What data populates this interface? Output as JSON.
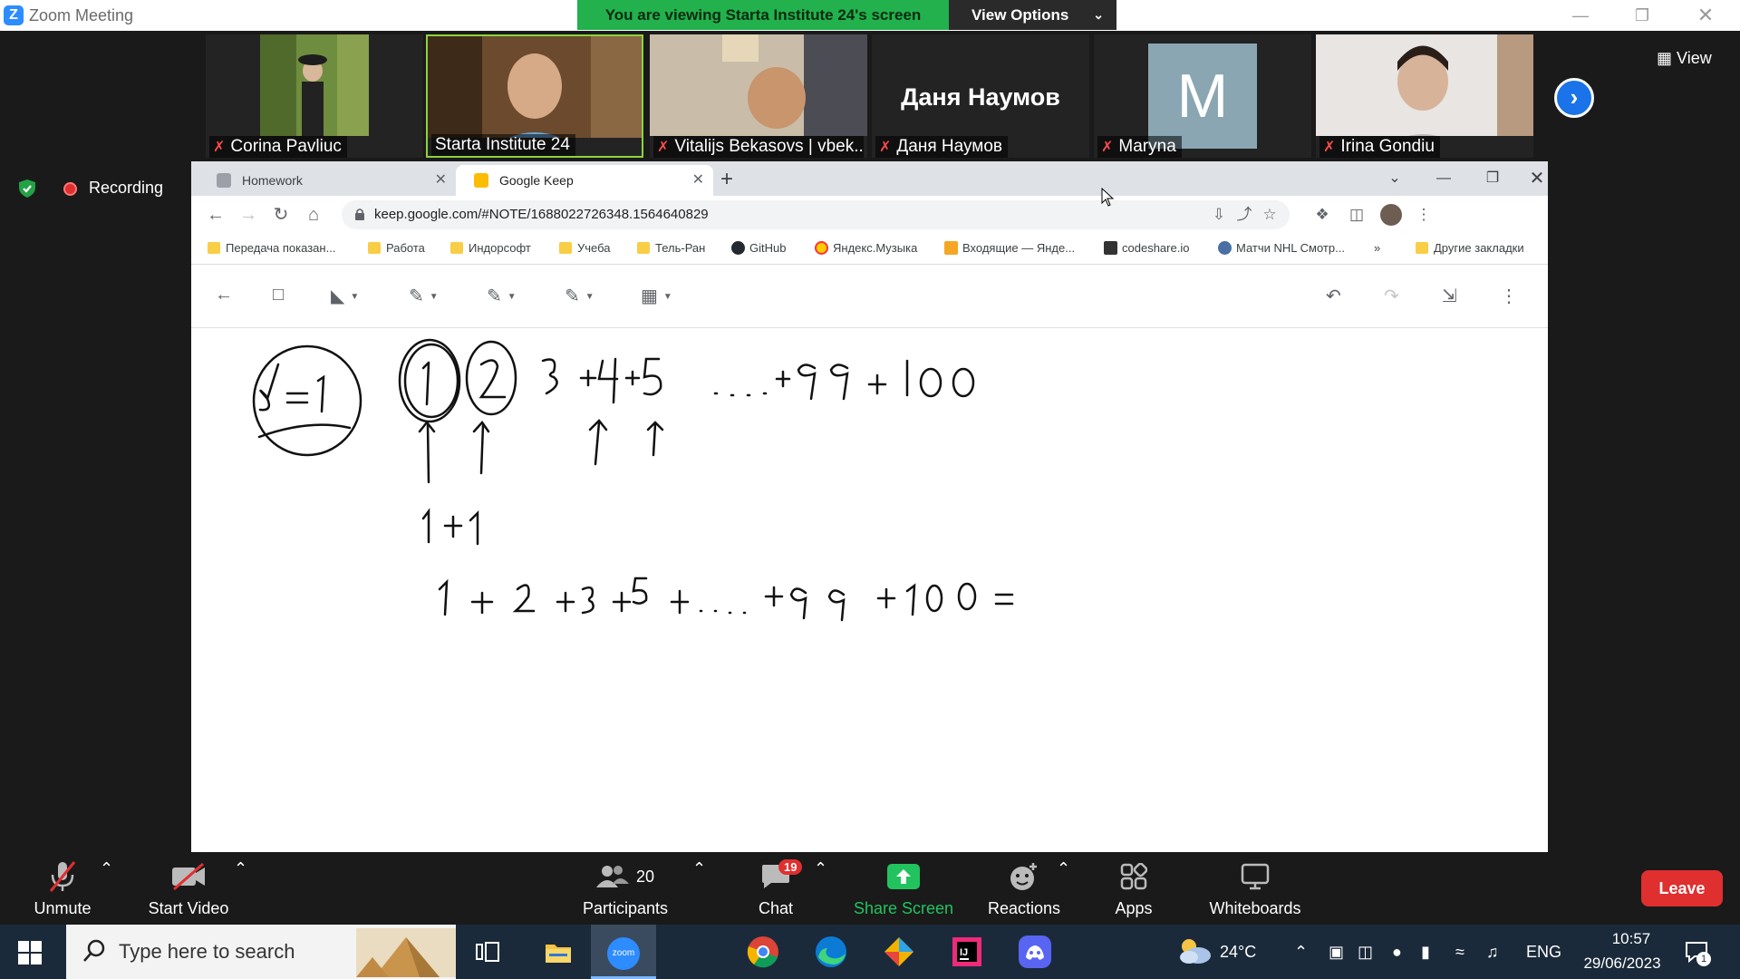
{
  "zoom": {
    "title": "Zoom Meeting",
    "banner": "You are viewing Starta Institute 24's screen",
    "view_options": "View Options",
    "view_btn": "View",
    "recording": "Recording",
    "participants": [
      {
        "name": "Corina Pavliuc",
        "muted": true
      },
      {
        "name": "Starta Institute 24",
        "muted": false,
        "active": true
      },
      {
        "name": "Vitalijs Bekasovs | vbek...",
        "muted": true
      },
      {
        "name": "Даня Наумов",
        "muted": true,
        "big_name": "Даня Наумов"
      },
      {
        "name": "Maryna",
        "muted": true,
        "initial": "M"
      },
      {
        "name": "Irina Gondiu",
        "muted": true
      }
    ],
    "controls": {
      "unmute": "Unmute",
      "start_video": "Start Video",
      "participants": "Participants",
      "participants_count": "20",
      "chat": "Chat",
      "chat_badge": "19",
      "share_screen": "Share Screen",
      "reactions": "Reactions",
      "apps": "Apps",
      "whiteboards": "Whiteboards",
      "leave": "Leave"
    },
    "colors": {
      "banner": "#22b14c",
      "leave": "#e02f2f",
      "accent": "#2d8cff"
    }
  },
  "chrome": {
    "tabs": [
      {
        "label": "Homework"
      },
      {
        "label": "Google Keep"
      }
    ],
    "url": "keep.google.com/#NOTE/1688022726348.1564640829",
    "bookmarks": [
      "Передача показан...",
      "Работа",
      "Индорсофт",
      "Учеба",
      "Тель-Ран",
      "GitHub",
      "Яндекс.Музыка",
      "Входящие — Янде...",
      "codeshare.io",
      "Матчи NHL Смотр...",
      "»",
      "Другие закладки"
    ]
  },
  "taskbar": {
    "search_placeholder": "Type here to search",
    "weather": "24°C",
    "lang": "ENG",
    "time": "10:57",
    "date": "29/06/2023",
    "notif_count": "1",
    "zoom_label": "zoom"
  }
}
